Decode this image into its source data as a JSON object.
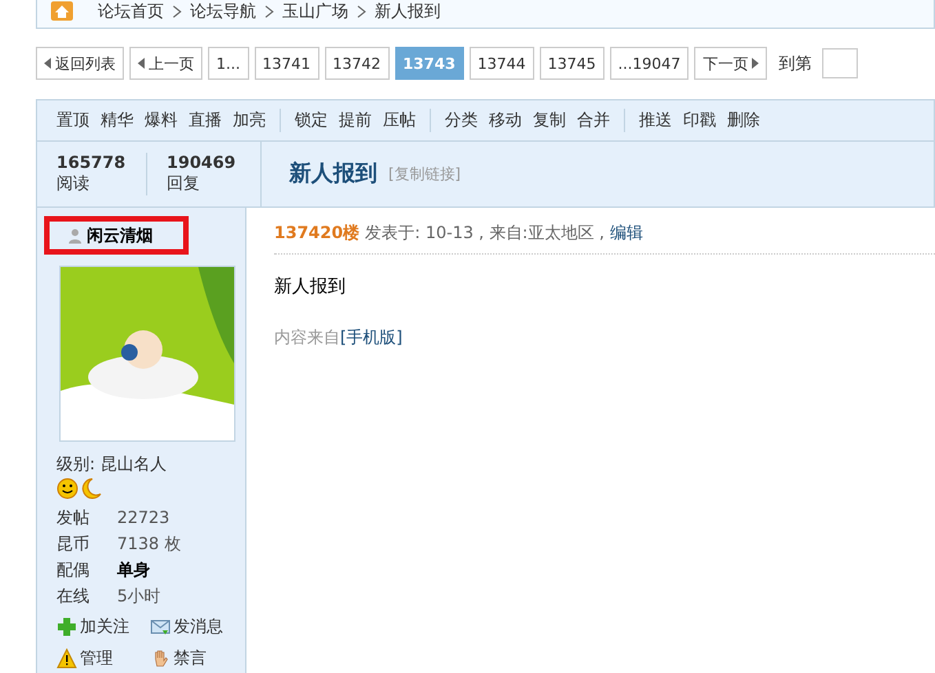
{
  "breadcrumb": [
    "论坛首页",
    "论坛导航",
    "玉山广场",
    "新人报到"
  ],
  "pager": {
    "back": "返回列表",
    "prev": "上一页",
    "pages": [
      {
        "label": "1...",
        "selected": false
      },
      {
        "label": "13741",
        "selected": false
      },
      {
        "label": "13742",
        "selected": false
      },
      {
        "label": "13743",
        "selected": true
      },
      {
        "label": "13744",
        "selected": false
      },
      {
        "label": "13745",
        "selected": false
      },
      {
        "label": "...19047",
        "selected": false
      }
    ],
    "next": "下一页",
    "goto_label": "到第"
  },
  "mod_actions": [
    [
      "置顶",
      "精华",
      "爆料",
      "直播",
      "加亮"
    ],
    [
      "锁定",
      "提前",
      "压帖"
    ],
    [
      "分类",
      "移动",
      "复制",
      "合并"
    ],
    [
      "推送",
      "印戳",
      "删除"
    ]
  ],
  "stats": [
    {
      "value": "165778",
      "label": "阅读"
    },
    {
      "value": "190469",
      "label": "回复"
    }
  ],
  "thread": {
    "title": "新人报到",
    "copy_link": "[复制链接]"
  },
  "author": {
    "name": "闲云清烟",
    "highlighted": true,
    "level_label": "级别:",
    "level": "昆山名人",
    "fields": [
      {
        "label": "发帖",
        "value": "22723",
        "bold": false
      },
      {
        "label": "昆币",
        "value": "7138 枚",
        "bold": false
      },
      {
        "label": "配偶",
        "value": "单身",
        "bold": true
      },
      {
        "label": "在线",
        "value": "5小时",
        "bold": false
      }
    ],
    "actions": [
      {
        "kind": "follow",
        "label": "加关注"
      },
      {
        "kind": "message",
        "label": "发消息"
      },
      {
        "kind": "manage",
        "label": "管理"
      },
      {
        "kind": "ban",
        "label": "禁言"
      }
    ]
  },
  "post": {
    "floor": "137420楼",
    "meta": "发表于: 10-13 , 来自:亚太地区 ,",
    "edit": "编辑",
    "body": "新人报到",
    "source_prefix": "内容来自",
    "source_link": "[手机版]"
  }
}
